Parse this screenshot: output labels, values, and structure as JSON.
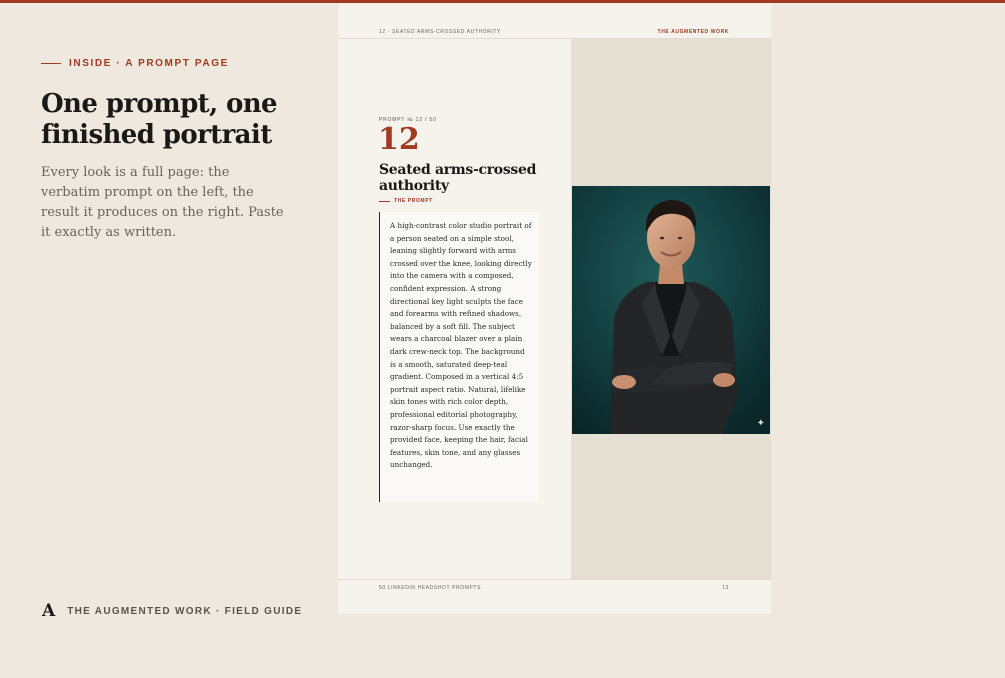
{
  "intro": {
    "eyebrow": "INSIDE · A PROMPT PAGE",
    "heading": "One prompt, one finished portrait",
    "description": "Every look is a full page: the verbatim prompt on the left, the result it produces on the right. Paste it exactly as written."
  },
  "brand": {
    "mark": "A",
    "label": "THE AUGMENTED WORK · FIELD GUIDE"
  },
  "spread": {
    "running_head_left": "12 · SEATED ARMS-CROSSED AUTHORITY",
    "running_head_right": "THE AUGMENTED WORK",
    "kicker": "PROMPT № 12 / 50",
    "number": "12",
    "title": "Seated arms-crossed authority",
    "prompt_label": "THE PROMPT",
    "prompt_text": "A high-contrast color studio portrait of a person seated on a simple stool, leaning slightly forward with arms crossed over the knee, looking directly into the camera with a composed, confident expression. A strong directional key light sculpts the face and forearms with refined shadows, balanced by a soft fill. The subject wears a charcoal blazer over a plain dark crew-neck top. The background is a smooth, saturated deep-teal gradient. Composed in a vertical 4:5 portrait aspect ratio. Natural, lifelike skin tones with rich color depth, professional editorial photography, razor-sharp focus. Use exactly the provided face, keeping the hair, facial features, skin tone, and any glasses unchanged.",
    "footer_left": "50 LINKEDIN HEADSHOT PROMPTS",
    "footer_right": "13"
  },
  "colors": {
    "accent": "#a13a21",
    "background": "#efe8df",
    "page": "#f6f2ec",
    "photo_background": "#0f3436"
  },
  "icons": {
    "photo_corner": "sparkle-icon"
  }
}
